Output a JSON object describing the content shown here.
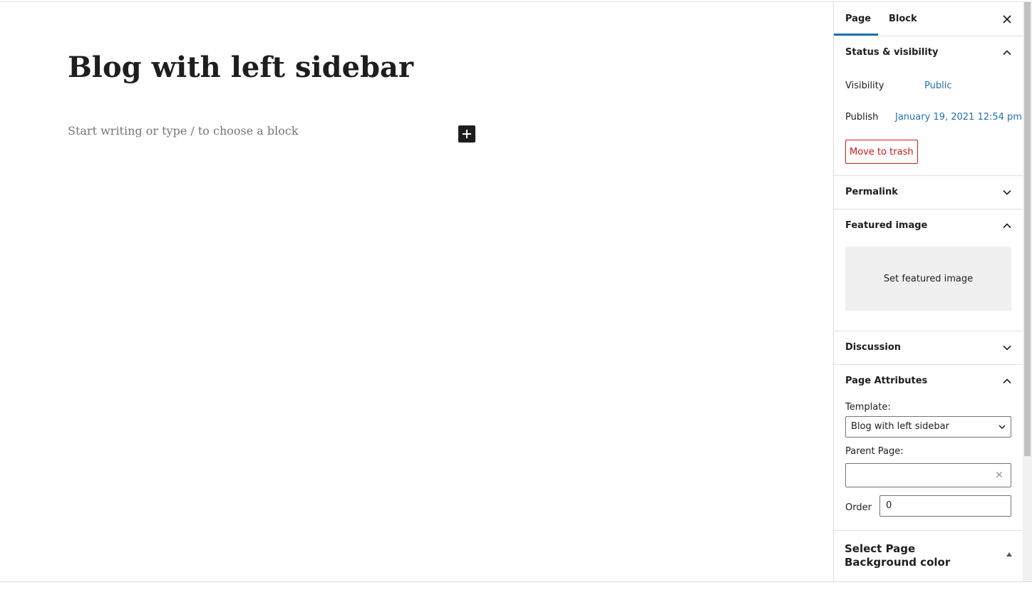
{
  "editor": {
    "title": "Blog with left sidebar",
    "placeholder": "Start writing or type / to choose a block",
    "inserter_icon": "plus-icon"
  },
  "sidebar": {
    "tabs": [
      {
        "label": "Page",
        "active": true
      },
      {
        "label": "Block",
        "active": false
      }
    ],
    "close_icon": "close-icon",
    "accent_color": "#2271b1",
    "danger_color": "#cc1818",
    "status": {
      "title": "Status & visibility",
      "visibility_label": "Visibility",
      "visibility_value": "Public",
      "publish_label": "Publish",
      "publish_value": "January 19, 2021 12:54 pm",
      "trash_label": "Move to trash"
    },
    "permalink": {
      "title": "Permalink"
    },
    "featured": {
      "title": "Featured image",
      "button": "Set featured image"
    },
    "discussion": {
      "title": "Discussion"
    },
    "attributes": {
      "title": "Page Attributes",
      "template_label": "Template:",
      "template_value": "Blog with left sidebar",
      "parent_label": "Parent Page:",
      "parent_value": "",
      "order_label": "Order",
      "order_value": "0"
    },
    "background": {
      "title": "Select Page Background color"
    }
  }
}
